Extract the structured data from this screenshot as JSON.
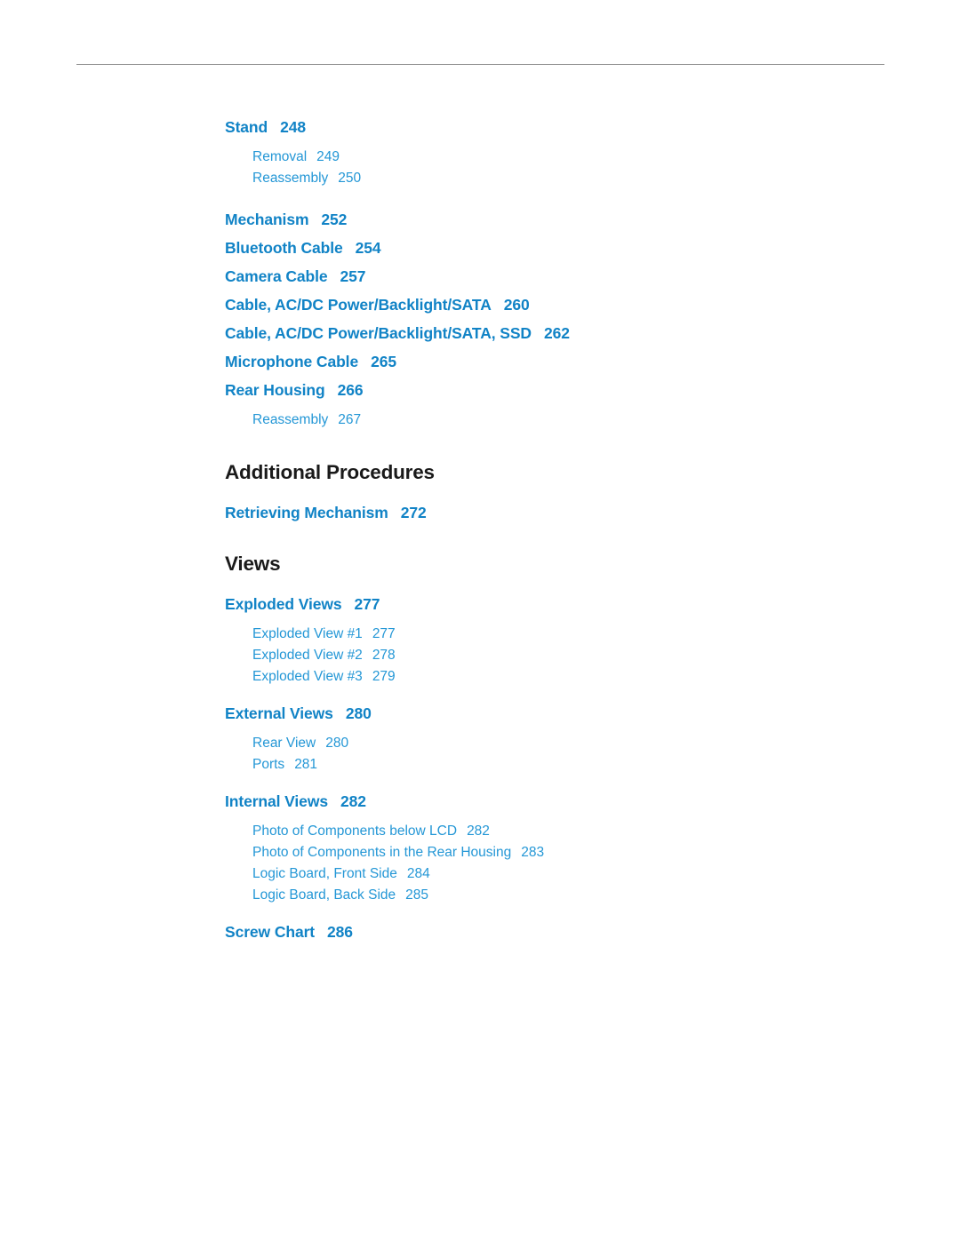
{
  "document": {
    "type": "table-of-contents",
    "entries": [
      {
        "level": 1,
        "label": "Stand",
        "page": "248"
      },
      {
        "level": 2,
        "label": "Removal",
        "page": "249"
      },
      {
        "level": 2,
        "label": "Reassembly",
        "page": "250"
      },
      {
        "level": 1,
        "label": "Mechanism",
        "page": "252"
      },
      {
        "level": 1,
        "label": "Bluetooth Cable",
        "page": "254"
      },
      {
        "level": 1,
        "label": "Camera Cable",
        "page": "257"
      },
      {
        "level": 1,
        "label": "Cable, AC/DC Power/Backlight/SATA",
        "page": "260"
      },
      {
        "level": 1,
        "label": "Cable, AC/DC Power/Backlight/SATA, SSD",
        "page": "262"
      },
      {
        "level": 1,
        "label": "Microphone Cable",
        "page": "265"
      },
      {
        "level": 1,
        "label": "Rear Housing",
        "page": "266"
      },
      {
        "level": 2,
        "label": "Reassembly",
        "page": "267"
      },
      {
        "level": 0,
        "label": "Additional Procedures",
        "page": ""
      },
      {
        "level": 1,
        "label": "Retrieving Mechanism",
        "page": "272"
      },
      {
        "level": 0,
        "label": "Views",
        "page": ""
      },
      {
        "level": 1,
        "label": "Exploded Views",
        "page": "277"
      },
      {
        "level": 2,
        "label": "Exploded View #1",
        "page": "277"
      },
      {
        "level": 2,
        "label": "Exploded View #2",
        "page": "278"
      },
      {
        "level": 2,
        "label": "Exploded View #3",
        "page": "279"
      },
      {
        "level": 1,
        "label": "External Views",
        "page": "280"
      },
      {
        "level": 2,
        "label": "Rear View",
        "page": "280"
      },
      {
        "level": 2,
        "label": "Ports",
        "page": "281"
      },
      {
        "level": 1,
        "label": "Internal Views",
        "page": "282"
      },
      {
        "level": 2,
        "label": "Photo of Components below LCD",
        "page": "282"
      },
      {
        "level": 2,
        "label": "Photo of Components in the Rear Housing",
        "page": "283"
      },
      {
        "level": 2,
        "label": "Logic Board, Front Side",
        "page": "284"
      },
      {
        "level": 2,
        "label": "Logic Board, Back Side",
        "page": "285"
      },
      {
        "level": 1,
        "label": "Screw Chart",
        "page": "286"
      }
    ],
    "colors": {
      "heading_blue": "#1183c6",
      "sub_blue": "#2497d6",
      "section_black": "#1a1a1a",
      "rule_gray": "#8a8a8a"
    }
  }
}
